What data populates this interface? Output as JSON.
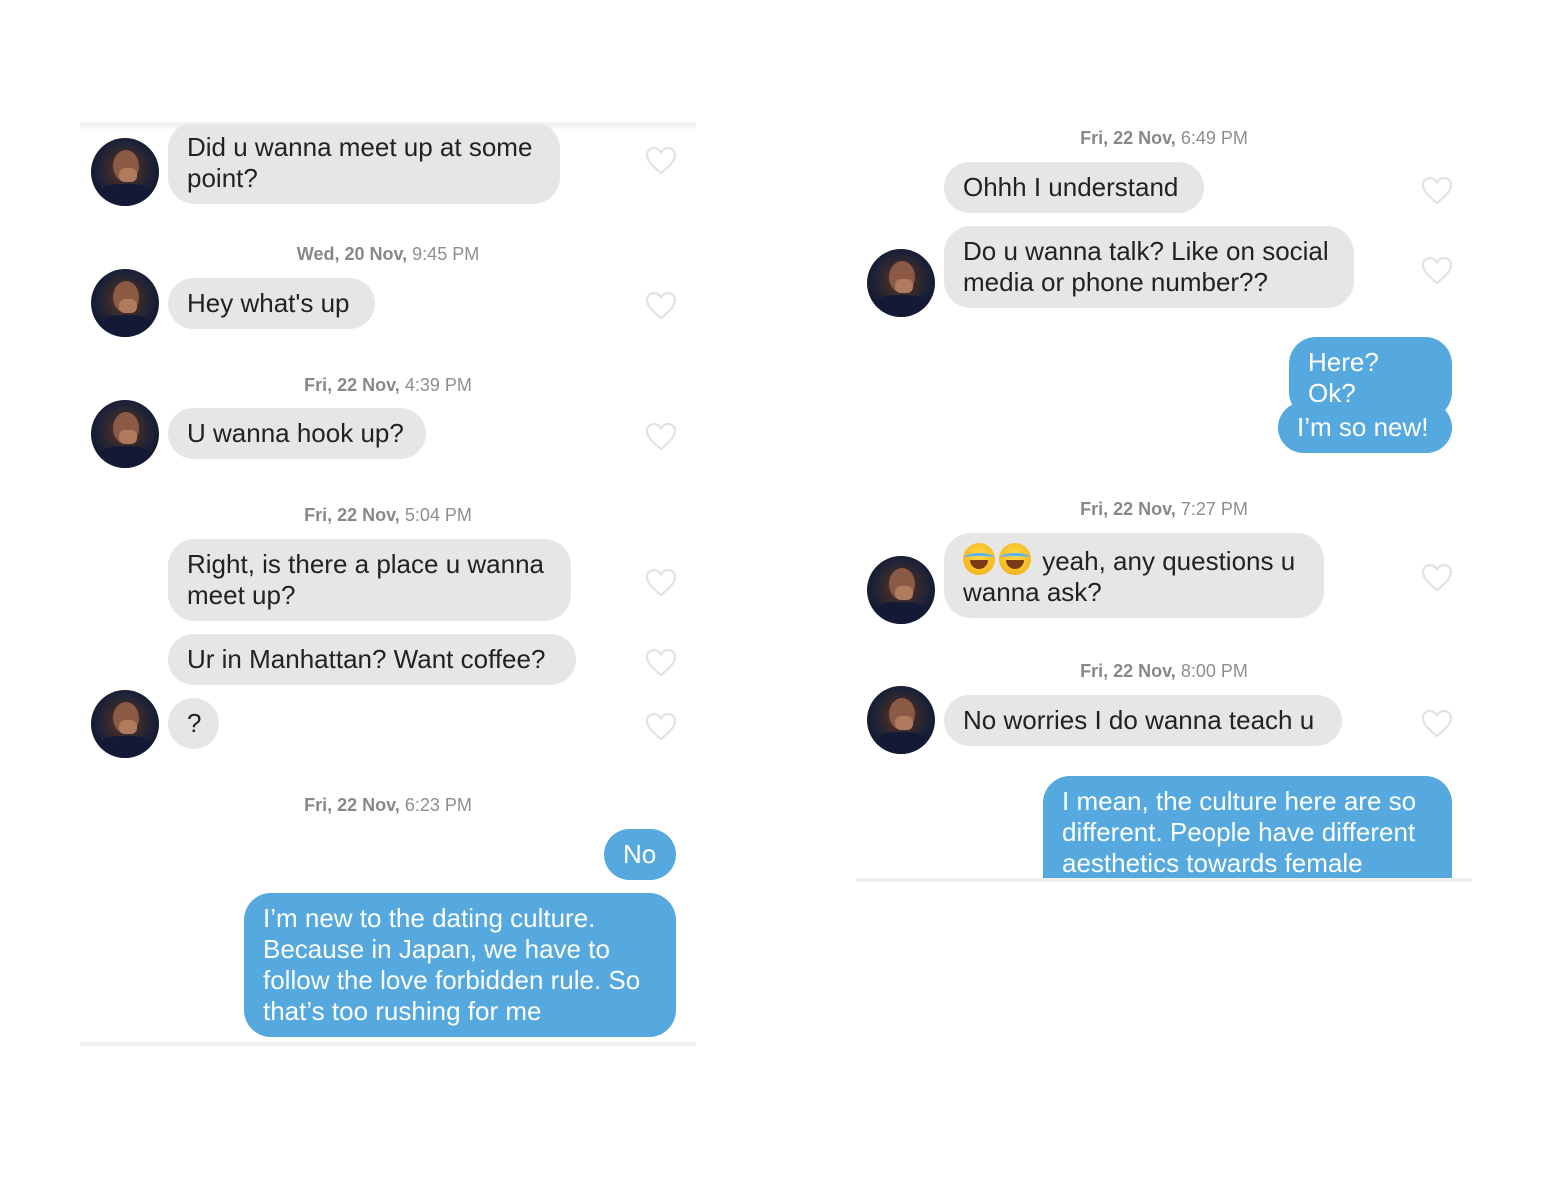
{
  "left_panel": {
    "messages": [
      {
        "kind": "them",
        "text": "Did u wanna meet up at some\npoint?"
      },
      {
        "kind": "stamp",
        "day": "Wed, 20 Nov,",
        "time": "9:45 PM"
      },
      {
        "kind": "them",
        "text": "Hey what's up"
      },
      {
        "kind": "stamp",
        "day": "Fri, 22 Nov,",
        "time": "4:39 PM"
      },
      {
        "kind": "them",
        "text": "U wanna hook up?"
      },
      {
        "kind": "stamp",
        "day": "Fri, 22 Nov,",
        "time": "5:04 PM"
      },
      {
        "kind": "them",
        "text": "Right, is there a place u wanna\nmeet up?"
      },
      {
        "kind": "them",
        "text": "Ur in Manhattan? Want coffee?"
      },
      {
        "kind": "them",
        "text": "?"
      },
      {
        "kind": "stamp",
        "day": "Fri, 22 Nov,",
        "time": "6:23 PM"
      },
      {
        "kind": "me",
        "text": "No"
      },
      {
        "kind": "me",
        "text": "I’m new to the dating culture.\nBecause in Japan, we have to\nfollow the love forbidden rule. So\nthat’s too rushing for me"
      }
    ]
  },
  "right_panel": {
    "messages": [
      {
        "kind": "stamp",
        "day": "Fri, 22 Nov,",
        "time": "6:49 PM"
      },
      {
        "kind": "them",
        "text": "Ohhh I understand"
      },
      {
        "kind": "them",
        "text": "Do u wanna talk? Like on social\nmedia or phone number??"
      },
      {
        "kind": "me",
        "text": "Here? Ok?"
      },
      {
        "kind": "me",
        "text": "I’m so new!"
      },
      {
        "kind": "stamp",
        "day": "Fri, 22 Nov,",
        "time": "7:27 PM"
      },
      {
        "kind": "them",
        "text": " yeah, any questions u\nwanna ask?",
        "emoji": "joy-emoji x2"
      },
      {
        "kind": "stamp",
        "day": "Fri, 22 Nov,",
        "time": "8:00 PM"
      },
      {
        "kind": "them",
        "text": "No worries I do wanna teach u"
      },
      {
        "kind": "me",
        "text": "I mean, the culture here are so\ndifferent. People have different\naesthetics towards female"
      }
    ]
  },
  "icons": {
    "like": "heart-outline-icon",
    "avatar": "match-avatar"
  },
  "colors": {
    "them_bubble": "#e6e6e6",
    "me_bubble": "#55a9de",
    "stamp_text": "#8e8e8e",
    "heart": "#e2e2e2"
  }
}
